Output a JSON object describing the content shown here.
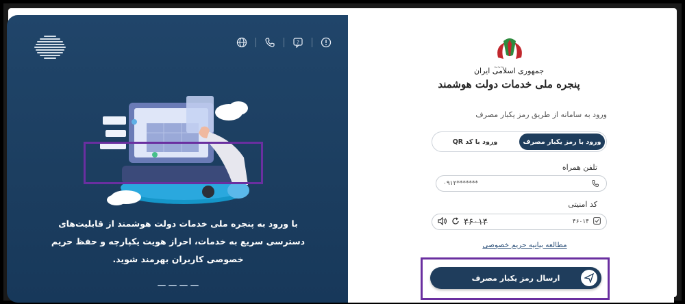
{
  "left_panel": {
    "description_lines": [
      "با ورود به پنجره ملی خدمات دولت هوشمند از قابلیت‌های",
      "دسترسی سریع به خدمات، احراز هویت یکپارچه و حفظ حریم",
      "خصوصی کاربران بهرمند شوید."
    ],
    "icons": [
      "info-icon",
      "chat-icon",
      "phone-icon",
      "globe-icon"
    ]
  },
  "right_panel": {
    "emblem_line1": "جمهوری اسلامی ایران",
    "emblem_line2": "پنجره ملی خدمات دولت هوشمند",
    "subtitle": "ورود به سامانه از طریق رمز یکبار مصرف",
    "tabs": [
      {
        "label": "ورود با رمز یکبار مصرف",
        "active": true
      },
      {
        "label": "ورود با کد QR",
        "active": false
      }
    ],
    "phone_label": "تلفن همراه",
    "phone_value": "۰۹۱۲*******",
    "security_label": "کد امنیتی",
    "security_value": "۴۶۰۱۴",
    "captcha_text": "۴۶۰۱۴",
    "privacy_link": "مطالعه بیانیه حریم خصوصی",
    "send_button": "ارسال رمز یکبار مصرف"
  },
  "colors": {
    "panel_blue": "#1f4468",
    "button_blue": "#1f3d5c",
    "highlight_purple": "#6a2fa0"
  }
}
